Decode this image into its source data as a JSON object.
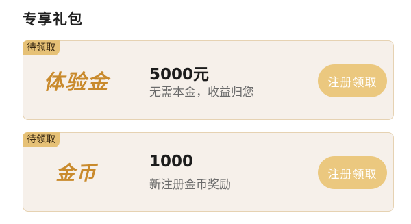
{
  "section": {
    "title": "专享礼包"
  },
  "cards": [
    {
      "badge": "待领取",
      "logo_text": "体验金",
      "amount": "5000元",
      "description": "无需本金，收益归您",
      "button_label": "注册领取"
    },
    {
      "badge": "待领取",
      "logo_text": "金币",
      "amount": "1000",
      "description": "新注册金币奖励",
      "button_label": "注册领取"
    }
  ],
  "colors": {
    "card_background": "#f6f0ea",
    "card_border": "#e6d2b2",
    "badge_background": "#e6c176",
    "logo_text": "#c98a2c",
    "button_background": "#ebc87f"
  }
}
